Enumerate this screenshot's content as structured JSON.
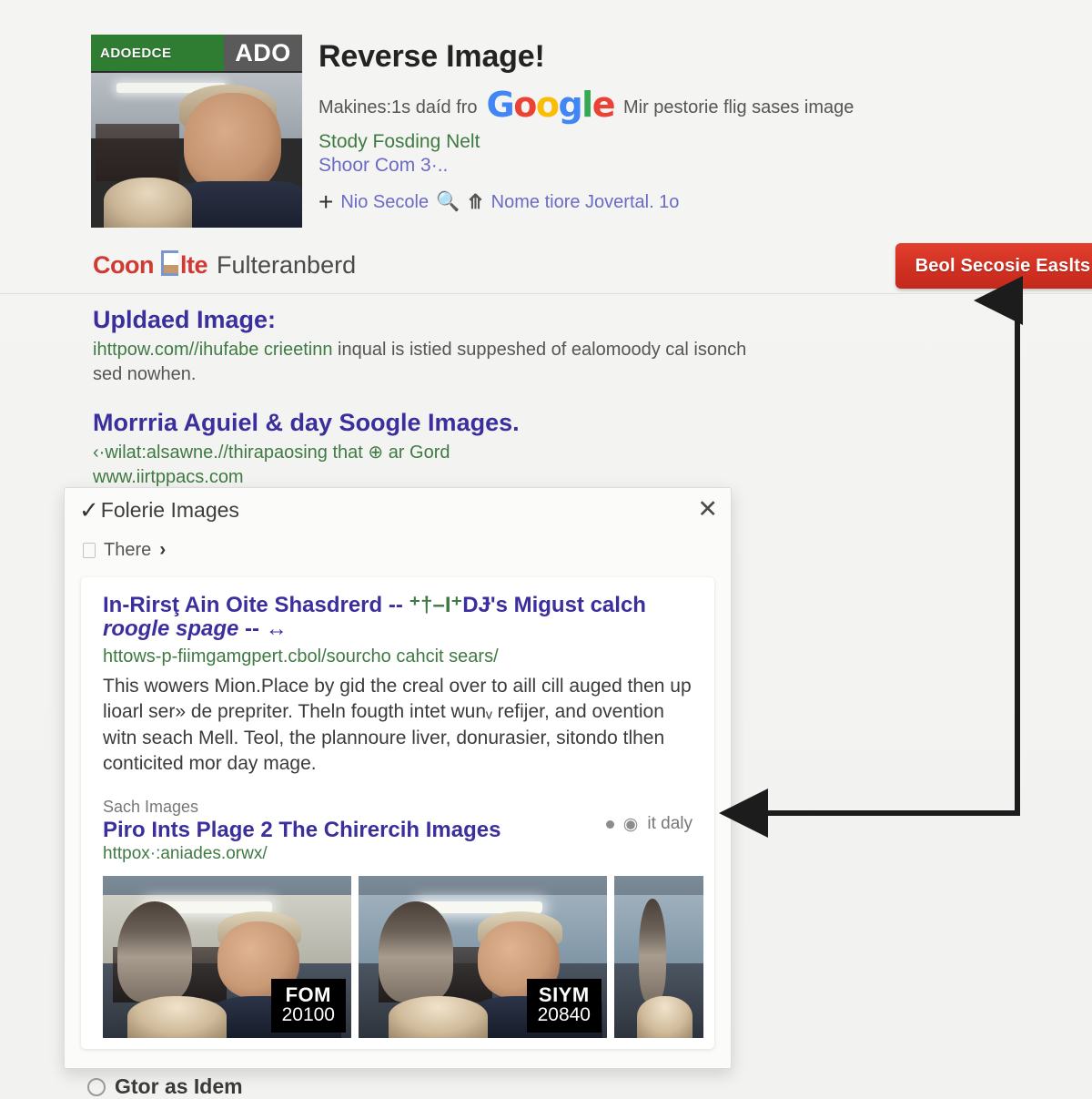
{
  "result": {
    "thumbnail": {
      "badge_green": "ADOEDCE",
      "badge_gray": "ADO"
    },
    "title": "Reverse Image!",
    "subtitle_before": "Makines:1s daíd fro",
    "brand_logo": "Google",
    "subtitle_after": "Mir pestorie flig sases image",
    "green_line": "Stody Fosding Nelt",
    "blue_line": "Shoor Com 3·..",
    "actions": {
      "plus_icon": "plus-icon",
      "plus_label": "Nio Secole",
      "search_icon": "magnifier-icon",
      "chevron_icon": "chevrons-up-icon",
      "chevron_label": "Nome tiore Jovertal. 1o"
    }
  },
  "brand": {
    "red_part_1": "Coon",
    "red_part_2": "lte",
    "gray_part": "Fulteranberd"
  },
  "cta": {
    "label": "Beol Secosie Easlts",
    "color": "#cf2f20"
  },
  "sections": [
    {
      "heading": "Upldaed Image:",
      "url": "ihttpow.com//ihufabe crieetinn",
      "body": " inqual is istied suppeshed of ealomoody cal isonch sed nowhen."
    },
    {
      "heading": "Morrria Aguiel & day Soogle Images.",
      "url_line_1": "‹·wilat:alsawne.//thirapaosing that ⊕ ar Gord",
      "url_line_2": "www.iirtppacs.com"
    }
  ],
  "dialog": {
    "check_icon": "checkmark-icon",
    "title": "Folerie Images",
    "close_icon": "close-icon",
    "subrow": {
      "square_icon": "square-icon",
      "label": "There",
      "chevron_icon": "chevron-right-icon"
    },
    "card": {
      "title_part_1": "In-Rirsţ Ain Oite Shasdrerd -- ",
      "title_green": "⁺†–I⁺",
      "title_part_2": "DɈ's Migust calch ",
      "title_italic": "roogle spage",
      "title_tail": " -- ↔",
      "url": "httows-p-fiimgamgpert.cbol/sourcho cahcit sears/",
      "snippet": "This wowers Mion.Place by gid the creal over to aill cill auged then up lioarl ser» de prepriter. Theln fougth intet wunᵥ refijer, and ovention witn seach Mell. Teol, the plannoure liver, donurasier, sitondo tlhen conticited mor day mage.",
      "kicker": "Sach Images",
      "sub_title": "Piro Ints Plage 2 The Chirercih Images",
      "sub_url": "httpox·:aniades.orwx/",
      "meta": {
        "dot_icon": "bullet-dot-icon",
        "glyph_icon": "aperture-icon",
        "label": "it daly"
      },
      "thumbnails": [
        {
          "label_top": "FOM",
          "label_bottom": "20100"
        },
        {
          "label_top": "SIYM",
          "label_bottom": "20840"
        },
        {
          "label_top": "",
          "label_bottom": ""
        }
      ]
    }
  },
  "bottom": {
    "radio_icon": "radio-button-icon",
    "label": "Gtor as Idem"
  },
  "annotation": {
    "arrow_icon": "double-headed-elbow-arrow",
    "color": "#1c1c1c"
  }
}
